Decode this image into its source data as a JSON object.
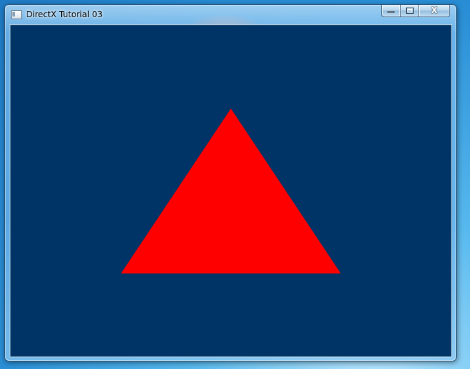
{
  "window": {
    "title": "DirectX Tutorial 03",
    "caption_buttons": {
      "minimize_icon": "minimize-icon",
      "maximize_icon": "maximize-icon",
      "close_glyph": "X"
    }
  },
  "scene": {
    "clear_color": "#003366",
    "triangle_color": "#ff0000"
  },
  "colors": {
    "desktop": "#2a8fd6",
    "window_frame": "#7dbef0"
  }
}
